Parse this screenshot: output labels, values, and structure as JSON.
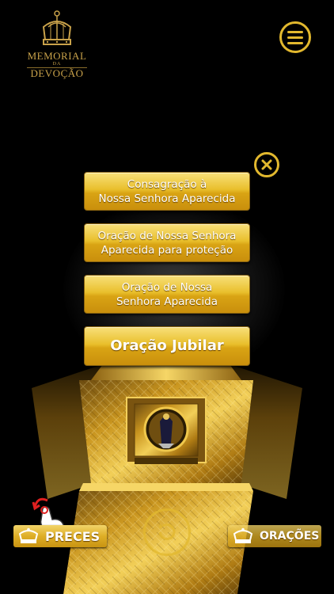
{
  "header": {
    "logo": {
      "line1": "MEMORIAL",
      "line2": "DA",
      "line3": "DEVOÇÃO",
      "icon": "crown-icon"
    },
    "menu_icon": "hamburger-menu-icon"
  },
  "popup": {
    "close_icon": "close-x-icon",
    "buttons": [
      {
        "line1": "Consagração à",
        "line2": "Nossa Senhora Aparecida"
      },
      {
        "line1": "Oração de Nossa Senhora",
        "line2": "Aparecida para proteção"
      },
      {
        "line1": "Oração de Nossa",
        "line2": "Senhora Aparecida"
      },
      {
        "label": "Oração Jubilar"
      }
    ]
  },
  "bottom_bar": {
    "preces_label": "PRECES",
    "oracoes_label": "ORAÇÕES",
    "rotate_icon": "rotate-icon",
    "hint_icon": "touch-hand-icon"
  },
  "colors": {
    "gold": "#e2b82e",
    "gold_dark": "#c98f0c",
    "background": "#000000",
    "text": "#ffffff"
  }
}
